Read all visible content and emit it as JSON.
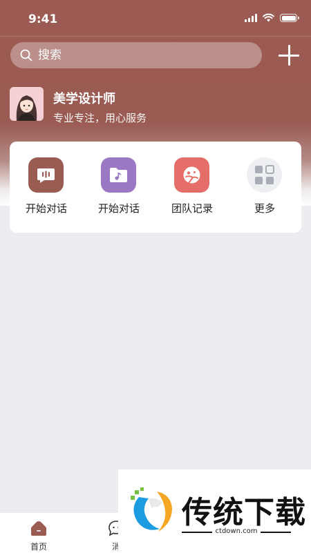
{
  "status_bar": {
    "time": "9:41"
  },
  "search": {
    "placeholder": "搜索"
  },
  "profile": {
    "name": "美学设计师",
    "subtitle": "专业专注，用心服务"
  },
  "actions": [
    {
      "label": "开始对话",
      "icon": "chat-bars-icon",
      "color": "#9a5b53"
    },
    {
      "label": "开始对话",
      "icon": "music-folder-icon",
      "color": "#9b78c4"
    },
    {
      "label": "团队记录",
      "icon": "game-face-icon",
      "color": "#e56e68"
    },
    {
      "label": "更多",
      "icon": "grid-more-icon",
      "color": "#eeeff2"
    }
  ],
  "tabs": [
    {
      "label": "首页",
      "icon": "home-icon",
      "active": true
    },
    {
      "label": "消",
      "icon": "message-icon",
      "active": false
    }
  ],
  "ad": {
    "brand": "传统下载",
    "domain": "ctdown.com"
  },
  "colors": {
    "header": "#9c5b52",
    "background": "#ecedf1"
  }
}
